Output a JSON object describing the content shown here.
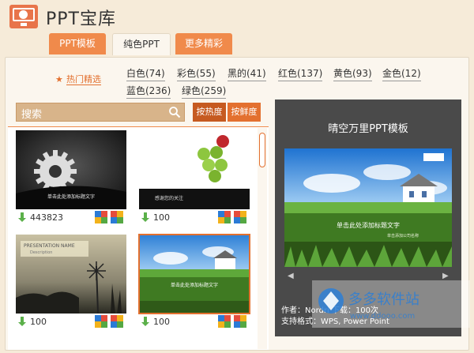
{
  "header": {
    "title": "PPT宝库",
    "tabs": [
      "PPT模板",
      "纯色PPT",
      "更多精彩"
    ]
  },
  "filters": {
    "hot_label": "热门精选",
    "colors": [
      "白色(74)",
      "彩色(55)",
      "黑的(41)",
      "红色(137)",
      "黄色(93)",
      "金色(12)",
      "蓝色(236)",
      "绿色(259)"
    ]
  },
  "search": {
    "placeholder": "搜索"
  },
  "sort": {
    "by_heat": "按热度",
    "by_fresh": "按鲜度"
  },
  "cards": [
    {
      "count": "443823",
      "caption": "单击此处添加标题文字"
    },
    {
      "count": "100",
      "caption": "感谢您的关注"
    },
    {
      "count": "100",
      "caption": "PRESENTATION NAME",
      "sub": "Description"
    },
    {
      "count": "100",
      "caption": "单击此处添加标题文字"
    }
  ],
  "preview": {
    "title": "晴空万里PPT模板",
    "slide_title": "单击此处添加标题文字",
    "slide_sub": "单击添加公司名称",
    "author": "作者：Nordri 下载：100次",
    "format": "支持格式：WPS, Power Point"
  },
  "watermark": {
    "text": "多多软件站",
    "url": "www.ddooo.com"
  },
  "colors": {
    "accent": "#f08a4b",
    "sort_active": "#e3702f",
    "panel_bg": "#fbf6ee"
  }
}
